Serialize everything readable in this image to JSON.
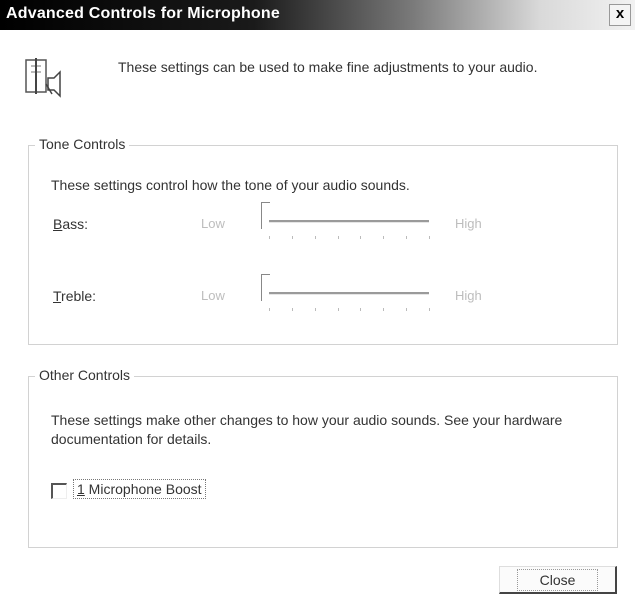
{
  "window": {
    "title": "Advanced Controls for Microphone",
    "close_glyph": "x"
  },
  "intro_text": "These settings can be used to make fine adjustments to your audio.",
  "tone_controls": {
    "legend": "Tone Controls",
    "description": "These settings control how the tone of your audio sounds.",
    "bass": {
      "mnemonic": "B",
      "label_rest": "ass:",
      "low_label": "Low",
      "high_label": "High",
      "level_fraction": 0.0
    },
    "treble": {
      "mnemonic": "T",
      "label_rest": "reble:",
      "low_label": "Low",
      "high_label": "High",
      "level_fraction": 0.0
    }
  },
  "other_controls": {
    "legend": "Other Controls",
    "description": "These settings make other changes to how your audio sounds.  See your hardware documentation for details.",
    "boost": {
      "mnemonic": "1",
      "label_rest": " Microphone Boost",
      "checked": false
    }
  },
  "close_button": {
    "label": "Close"
  },
  "icons": {
    "header_icon": "speaker-settings-icon",
    "close_icon": "close-icon"
  }
}
